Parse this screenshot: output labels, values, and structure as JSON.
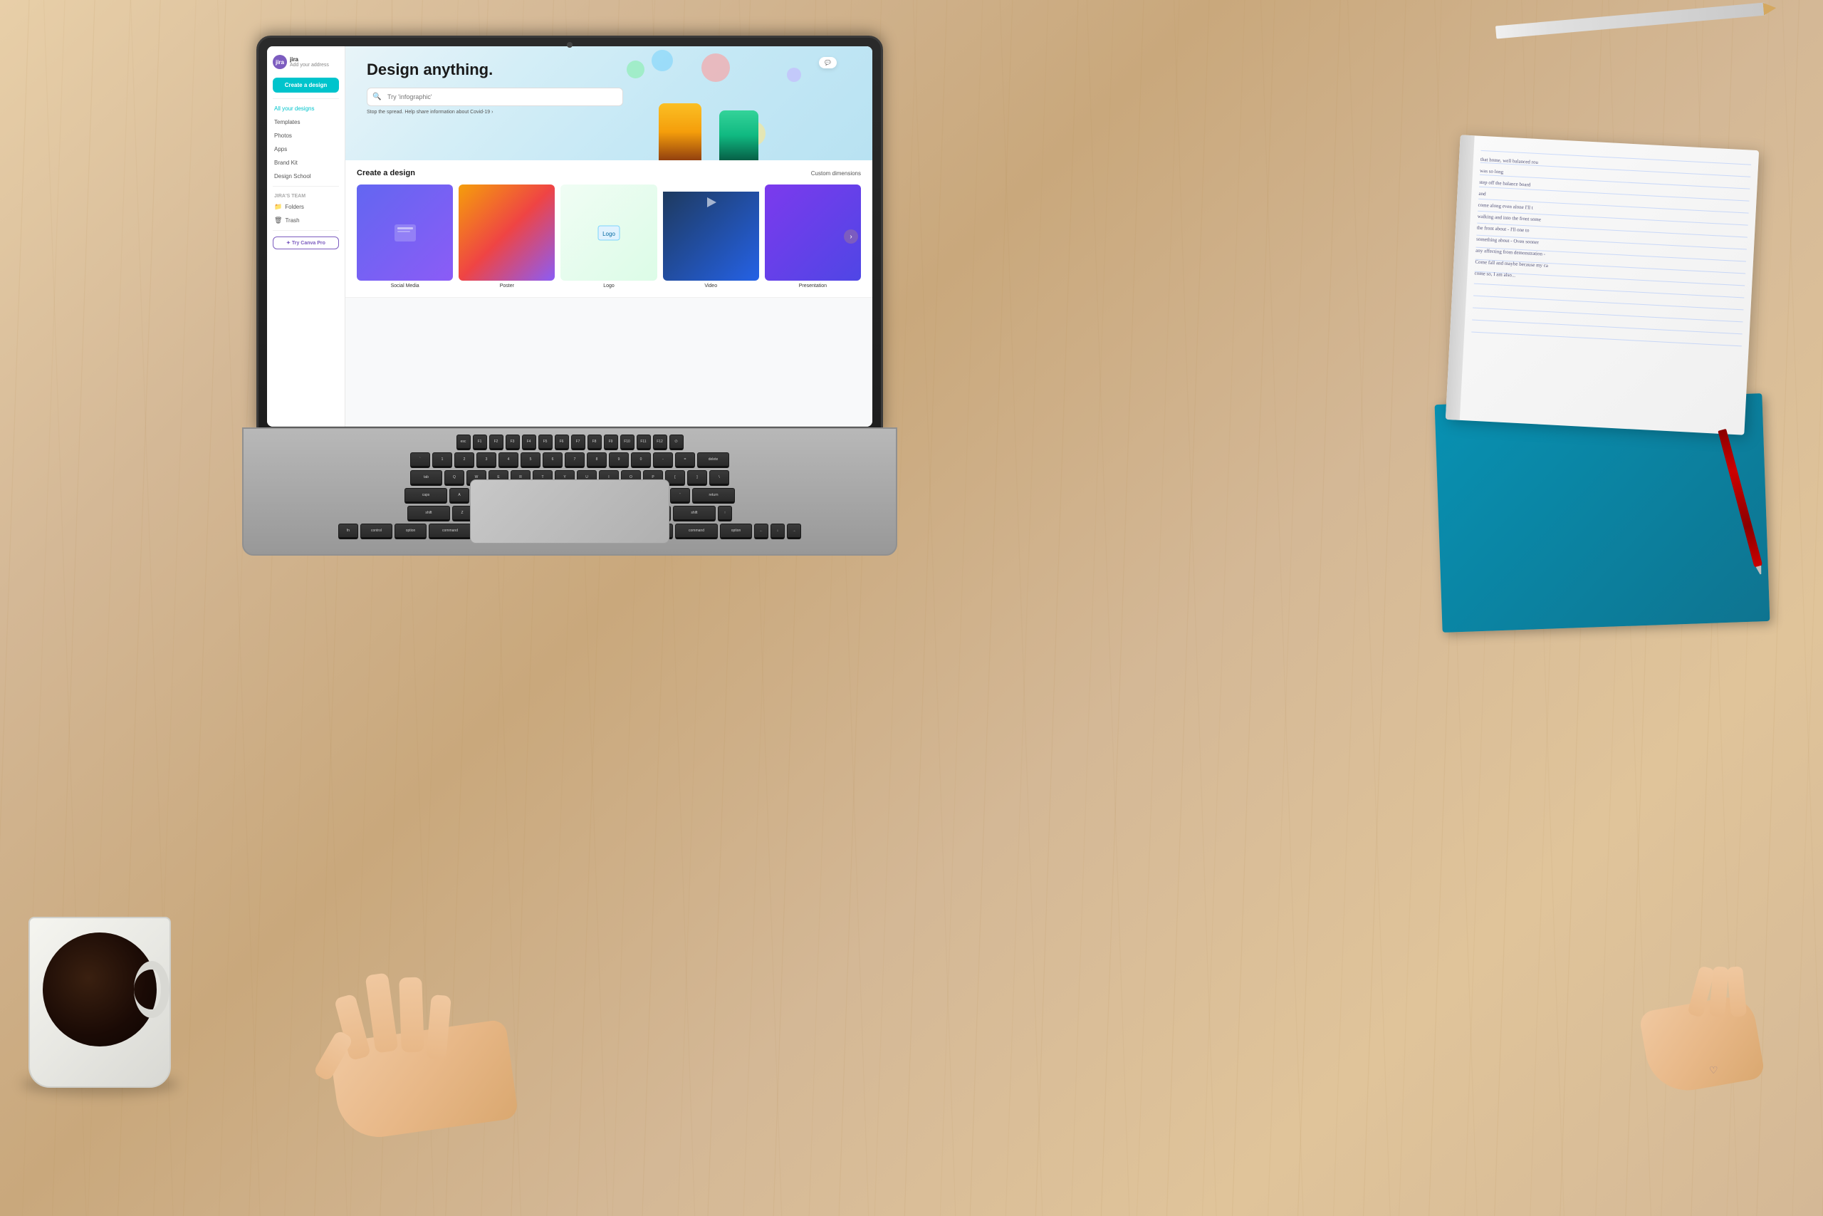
{
  "scene": {
    "background": "wooden desk with laptop, coffee, notebooks",
    "colors": {
      "desk": "#d4b896",
      "laptop_frame": "#2a2a2a",
      "canva_accent": "#00c4cc",
      "canva_purple": "#7c5cbf"
    }
  },
  "canva": {
    "sidebar": {
      "user_name": "jira",
      "user_sub": "Add your address",
      "create_btn_label": "Create a design",
      "nav_items": [
        {
          "label": "All your designs"
        },
        {
          "label": "Templates"
        },
        {
          "label": "Photos"
        },
        {
          "label": "Apps"
        },
        {
          "label": "Brand Kit"
        },
        {
          "label": "Design School"
        }
      ],
      "team_label": "jira's team",
      "folder_items": [
        {
          "icon": "📁",
          "label": "Folders"
        },
        {
          "icon": "🗑",
          "label": "Trash"
        }
      ],
      "try_pro_label": "✦ Try Canva Pro"
    },
    "hero": {
      "title": "Design anything.",
      "search_placeholder": "Try 'infographic'",
      "covid_notice": "Stop the spread. Help share information about Covid-19 ›"
    },
    "create_section": {
      "title": "Create a design",
      "custom_dims_label": "Custom dimensions",
      "templates": [
        {
          "label": "Social Media"
        },
        {
          "label": "Poster"
        },
        {
          "label": "Logo"
        },
        {
          "label": "Video"
        },
        {
          "label": "Presentation"
        }
      ]
    }
  },
  "keyboard": {
    "option_key_label": "option"
  },
  "notebook": {
    "handwriting_lines": [
      "that home, well balanced rou",
      "was so long",
      "step off the balance board",
      "and",
      "come along even alone I'll t",
      "walking and into the front some",
      "the front about - I'll one to",
      "something about - Oven sooner",
      "any affecting from demonstration -",
      "Come fall and maybe because my ca",
      "come so, I am also..."
    ]
  }
}
